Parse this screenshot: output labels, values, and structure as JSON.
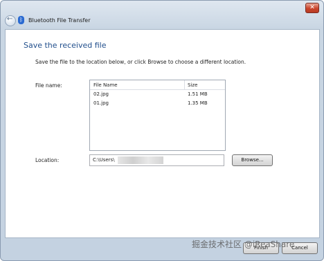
{
  "window": {
    "title": "Bluetooth File Transfer",
    "close_glyph": "✕",
    "back_glyph": "←"
  },
  "main": {
    "heading": "Save the received file",
    "instruction": "Save the file to the location below, or click Browse to choose a different location.",
    "file_name_label": "File name:",
    "columns": {
      "name": "File Name",
      "size": "Size"
    },
    "files": [
      {
        "name": "02.jpg",
        "size": "1.51 MB"
      },
      {
        "name": "01.jpg",
        "size": "1.35 MB"
      }
    ],
    "location_label": "Location:",
    "location_value": "C:\\Users\\",
    "browse_label": "Browse..."
  },
  "footer": {
    "finish_label": "Finish",
    "cancel_label": "Cancel"
  },
  "watermark": "掘金技术社区 @iReaShare",
  "colors": {
    "heading": "#1f4d8b",
    "close_button": "#c9452d",
    "bluetooth": "#2a6ad1"
  },
  "icons": [
    "back-arrow-icon",
    "bluetooth-icon",
    "close-icon"
  ]
}
